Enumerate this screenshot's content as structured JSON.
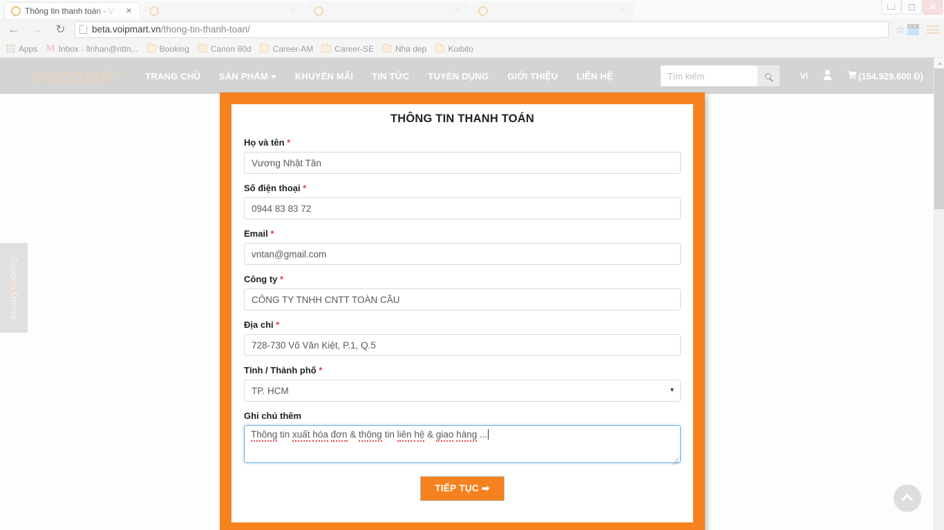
{
  "browser": {
    "active_tab_title": "Thông tin thanh toán - VO",
    "tab_close_glyph": "×",
    "background_tabs": [
      "",
      "",
      ""
    ],
    "back_glyph": "←",
    "forward_glyph": "→",
    "reload_glyph": "↻",
    "url_host": "beta.voipmart.vn",
    "url_path": "/thong-tin-thanh-toan/",
    "star_glyph": "☆",
    "window_close_glyph": "✕",
    "bookmarks": [
      {
        "label": "Apps",
        "icon": "apps-grid-icon"
      },
      {
        "label": "Inbox - ltnhan@nttn...",
        "icon": "gmail-icon"
      },
      {
        "label": "Booking",
        "icon": "folder-icon"
      },
      {
        "label": "Canon 60d",
        "icon": "folder-icon"
      },
      {
        "label": "Career-AM",
        "icon": "folder-icon"
      },
      {
        "label": "Career-SE",
        "icon": "folder-icon"
      },
      {
        "label": "Nha dep",
        "icon": "folder-icon"
      },
      {
        "label": "Koibito",
        "icon": "folder-icon"
      }
    ]
  },
  "site": {
    "logo_text": "voipmart",
    "logo_mark": "®",
    "menu": [
      {
        "label": "TRANG CHỦ",
        "has_caret": false
      },
      {
        "label": "SẢN PHẨM",
        "has_caret": true
      },
      {
        "label": "KHUYẾN MÃI",
        "has_caret": false
      },
      {
        "label": "TIN TỨC",
        "has_caret": false
      },
      {
        "label": "TUYỂN DỤNG",
        "has_caret": false
      },
      {
        "label": "GIỚI THIỆU",
        "has_caret": false
      },
      {
        "label": "LIÊN HỆ",
        "has_caret": false
      }
    ],
    "search_placeholder": "Tìm kiếm",
    "search_value": "",
    "language": "VI",
    "user_glyph": "♟",
    "cart_glyph": "🛒",
    "cart_total": "(154.929.600 Đ)",
    "accent_color": "#f5821f",
    "header_bg": "#d4d4d4"
  },
  "form": {
    "title": "THÔNG TIN THANH TOÁN",
    "required_mark": "*",
    "fields": [
      {
        "label": "Họ và tên",
        "required": true,
        "value": "Vương Nhật Tân",
        "type": "text"
      },
      {
        "label": "Số điện thoại",
        "required": true,
        "value": "0944 83 83 72",
        "type": "text"
      },
      {
        "label": "Email",
        "required": true,
        "value": "vntan@gmail.com",
        "type": "text"
      },
      {
        "label": "Công ty",
        "required": true,
        "value": "CÔNG TY TNHH CNTT TOÀN CẦU",
        "type": "text"
      },
      {
        "label": "Địa chỉ",
        "required": true,
        "value": "728-730 Võ Văn Kiệt, P.1, Q.5",
        "type": "text"
      },
      {
        "label": "Tỉnh / Thành phố",
        "required": true,
        "value": "TP. HCM",
        "type": "select"
      }
    ],
    "select_arrow_glyph": "▾",
    "province_options": [
      "TP. HCM"
    ],
    "note_label": "Ghi chú thêm",
    "note_required": false,
    "note_value": "Thông tin xuất hóa đơn & thông tin liên hệ & giao hàng ...",
    "note_focused": true,
    "submit_label": "TIẾP TỤC",
    "submit_arrow": "➡"
  },
  "widgets": {
    "support_label": "Support Online",
    "back_to_top_name": "chevron-up-icon"
  }
}
